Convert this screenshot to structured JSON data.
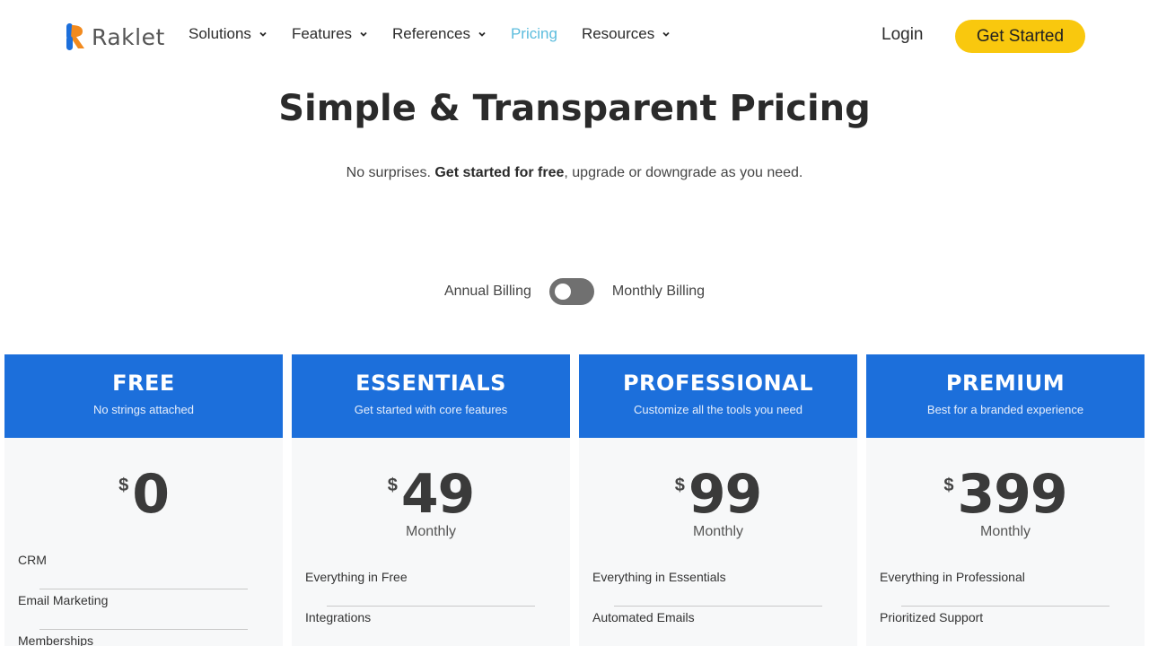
{
  "brand": {
    "name": "Raklet"
  },
  "nav": {
    "items": [
      {
        "label": "Solutions",
        "has_menu": true
      },
      {
        "label": "Features",
        "has_menu": true
      },
      {
        "label": "References",
        "has_menu": true
      },
      {
        "label": "Pricing",
        "has_menu": false,
        "active": true
      },
      {
        "label": "Resources",
        "has_menu": true
      }
    ],
    "login": "Login",
    "cta": "Get Started"
  },
  "hero": {
    "title": "Simple & Transparent Pricing",
    "sub_before": "No surprises. ",
    "sub_bold": "Get started for free",
    "sub_after": ", upgrade or downgrade as you need."
  },
  "billing": {
    "annual": "Annual Billing",
    "monthly": "Monthly Billing",
    "toggle_state": "annual"
  },
  "plans": [
    {
      "name": "FREE",
      "tagline": "No strings attached",
      "currency": "$",
      "price": "0",
      "period": "",
      "features": [
        "CRM",
        "Email Marketing",
        "Memberships"
      ]
    },
    {
      "name": "ESSENTIALS",
      "tagline": "Get started with core features",
      "currency": "$",
      "price": "49",
      "period": "Monthly",
      "features": [
        "Everything in Free",
        "Integrations"
      ]
    },
    {
      "name": "PROFESSIONAL",
      "tagline": "Customize all the tools you need",
      "currency": "$",
      "price": "99",
      "period": "Monthly",
      "features": [
        "Everything in Essentials",
        "Automated Emails"
      ]
    },
    {
      "name": "PREMIUM",
      "tagline": "Best for a branded experience",
      "currency": "$",
      "price": "399",
      "period": "Monthly",
      "features": [
        "Everything in Professional",
        "Prioritized Support"
      ]
    }
  ],
  "colors": {
    "accent": "#1c6fdb",
    "cta": "#f9c80e",
    "active_nav": "#5bbcdd",
    "toggle": "#707070"
  }
}
